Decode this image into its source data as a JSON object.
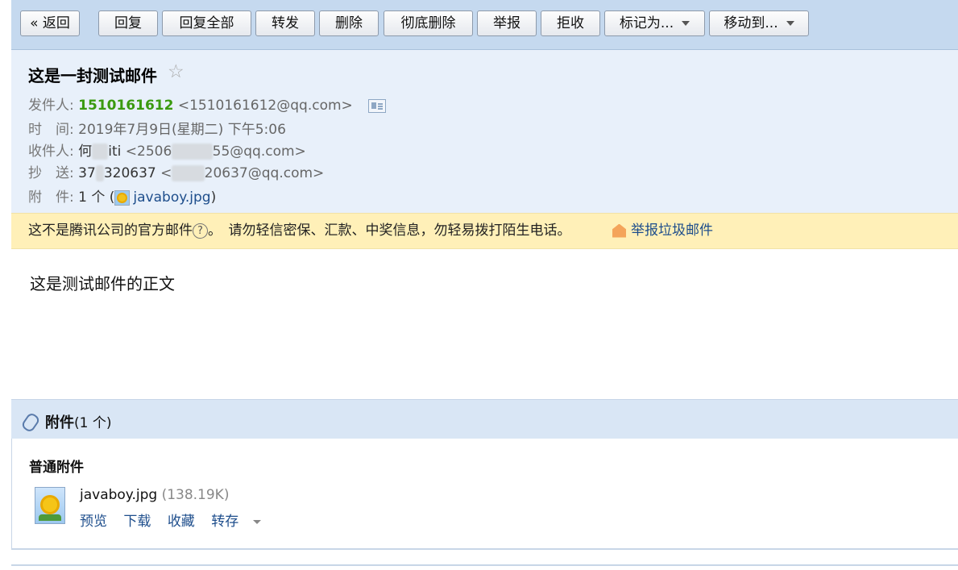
{
  "toolbar": {
    "back": "« 返回",
    "reply": "回复",
    "reply_all": "回复全部",
    "forward": "转发",
    "delete": "删除",
    "delete_permanent": "彻底删除",
    "report": "举报",
    "reject": "拒收",
    "mark_as": "标记为...",
    "move_to": "移动到..."
  },
  "mail": {
    "subject": "这是一封测试邮件",
    "star": "☆",
    "from_label": "发件人:",
    "from_name": "1510161612",
    "from_addr": "<1510161612@qq.com>",
    "time_label": "时　间:",
    "time_value": "2019年7月9日(星期二) 下午5:06",
    "to_label": "收件人:",
    "to_name_a": "何",
    "to_name_b": "iti",
    "to_addr_a": "<2506",
    "to_addr_b": "55@qq.com>",
    "cc_label": "抄　送:",
    "cc_name_a": "37",
    "cc_name_b": "320637",
    "cc_addr_a": "<",
    "cc_addr_b": "20637@qq.com>",
    "att_label": "附　件:",
    "att_count": "1 个 (",
    "att_name": "javaboy.jpg",
    "att_close": ")"
  },
  "warning": {
    "text_a": "这不是腾讯公司的官方邮件",
    "qmark": "?",
    "text_b": "。　请勿轻信密保、汇款、中奖信息，勿轻易拨打陌生电话。",
    "report_link": "举报垃圾邮件"
  },
  "body_text": "这是测试邮件的正文",
  "attachments": {
    "title": "附件",
    "count": "(1 个)",
    "section": "普通附件",
    "file_name": "javaboy.jpg",
    "file_size": "(138.19K)",
    "actions": [
      "预览",
      "下载",
      "收藏",
      "转存"
    ]
  }
}
